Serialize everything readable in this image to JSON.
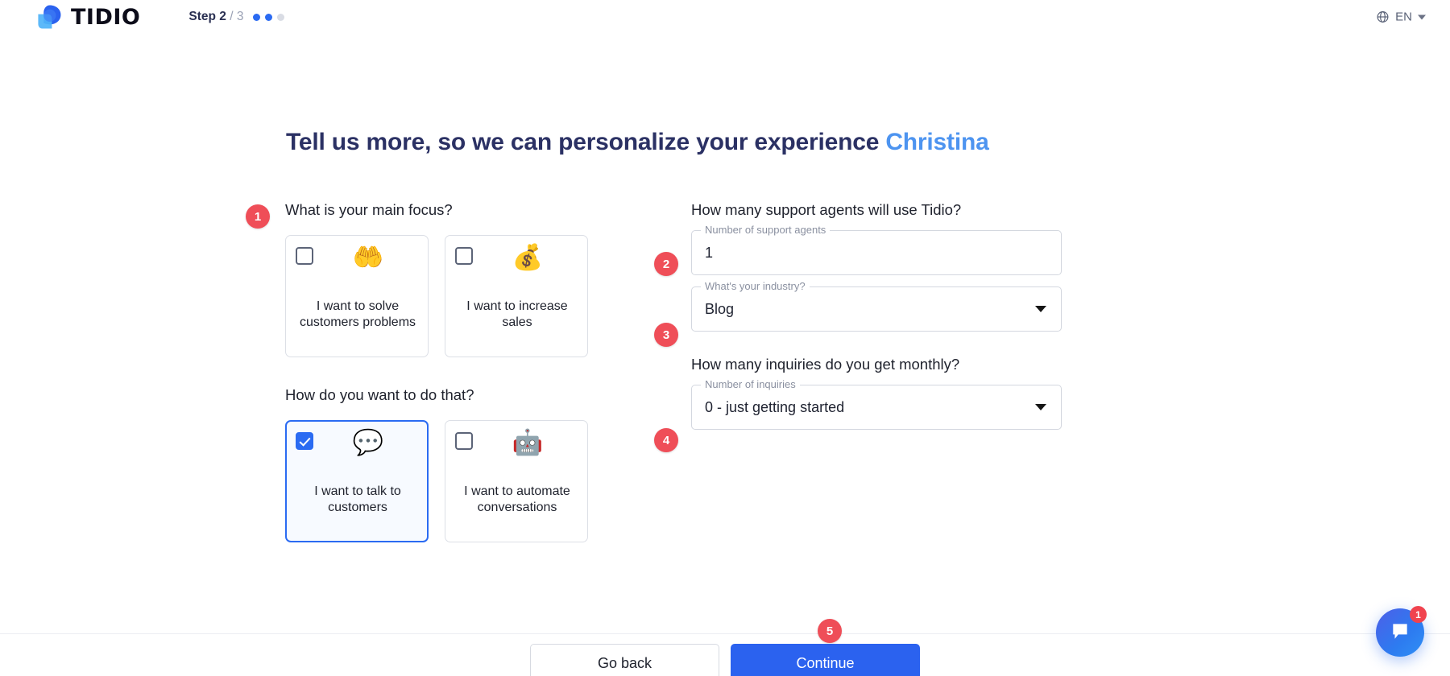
{
  "header": {
    "brand_name": "TIDIO",
    "logo_icon": "tidio-chat-logo",
    "step_label": "Step 2",
    "step_total": "/ 3",
    "dots_total": 3,
    "dots_active": 2,
    "language_icon": "globe-icon",
    "language_code": "EN",
    "language_caret_icon": "chevron-down-icon"
  },
  "headline": {
    "text": "Tell us more, so we can personalize your experience",
    "name": "Christina"
  },
  "left_column": {
    "question_1": "What is your main focus?",
    "question_2": "How do you want to do that?",
    "focus_options": [
      {
        "label": "I want to solve customers problems",
        "emoji": "🤲",
        "emoji_name": "open-hands-emoji",
        "checked": false
      },
      {
        "label": "I want to increase sales",
        "emoji": "💰",
        "emoji_name": "money-bag-emoji",
        "checked": false
      }
    ],
    "method_options": [
      {
        "label": "I want to talk to customers",
        "emoji": "💬",
        "emoji_name": "speech-balloon-emoji",
        "checked": true
      },
      {
        "label": "I want to automate conversations",
        "emoji": "🤖",
        "emoji_name": "robot-emoji",
        "checked": false
      }
    ]
  },
  "right_column": {
    "question_agents": "How many support agents will use Tidio?",
    "agents_field": {
      "label": "Number of support agents",
      "value": "1"
    },
    "industry_field": {
      "label": "What's your industry?",
      "value": "Blog",
      "caret_icon": "dropdown-triangle-icon"
    },
    "question_inquiries": "How many inquiries do you get monthly?",
    "inquiries_field": {
      "label": "Number of inquiries",
      "value": "0 - just getting started",
      "caret_icon": "dropdown-triangle-icon"
    }
  },
  "badges": {
    "b1": "1",
    "b2": "2",
    "b3": "3",
    "b4": "4",
    "b5": "5"
  },
  "footer": {
    "back_label": "Go back",
    "continue_label": "Continue"
  },
  "chat_widget": {
    "icon": "chat-bubble-icon",
    "unread_count": "1"
  },
  "colors": {
    "primary_blue": "#2b62ef",
    "headline_navy": "#2b3164",
    "name_blue": "#4d94f0",
    "badge_red": "#ef4e58",
    "chat_badge_red": "#f0434f"
  }
}
